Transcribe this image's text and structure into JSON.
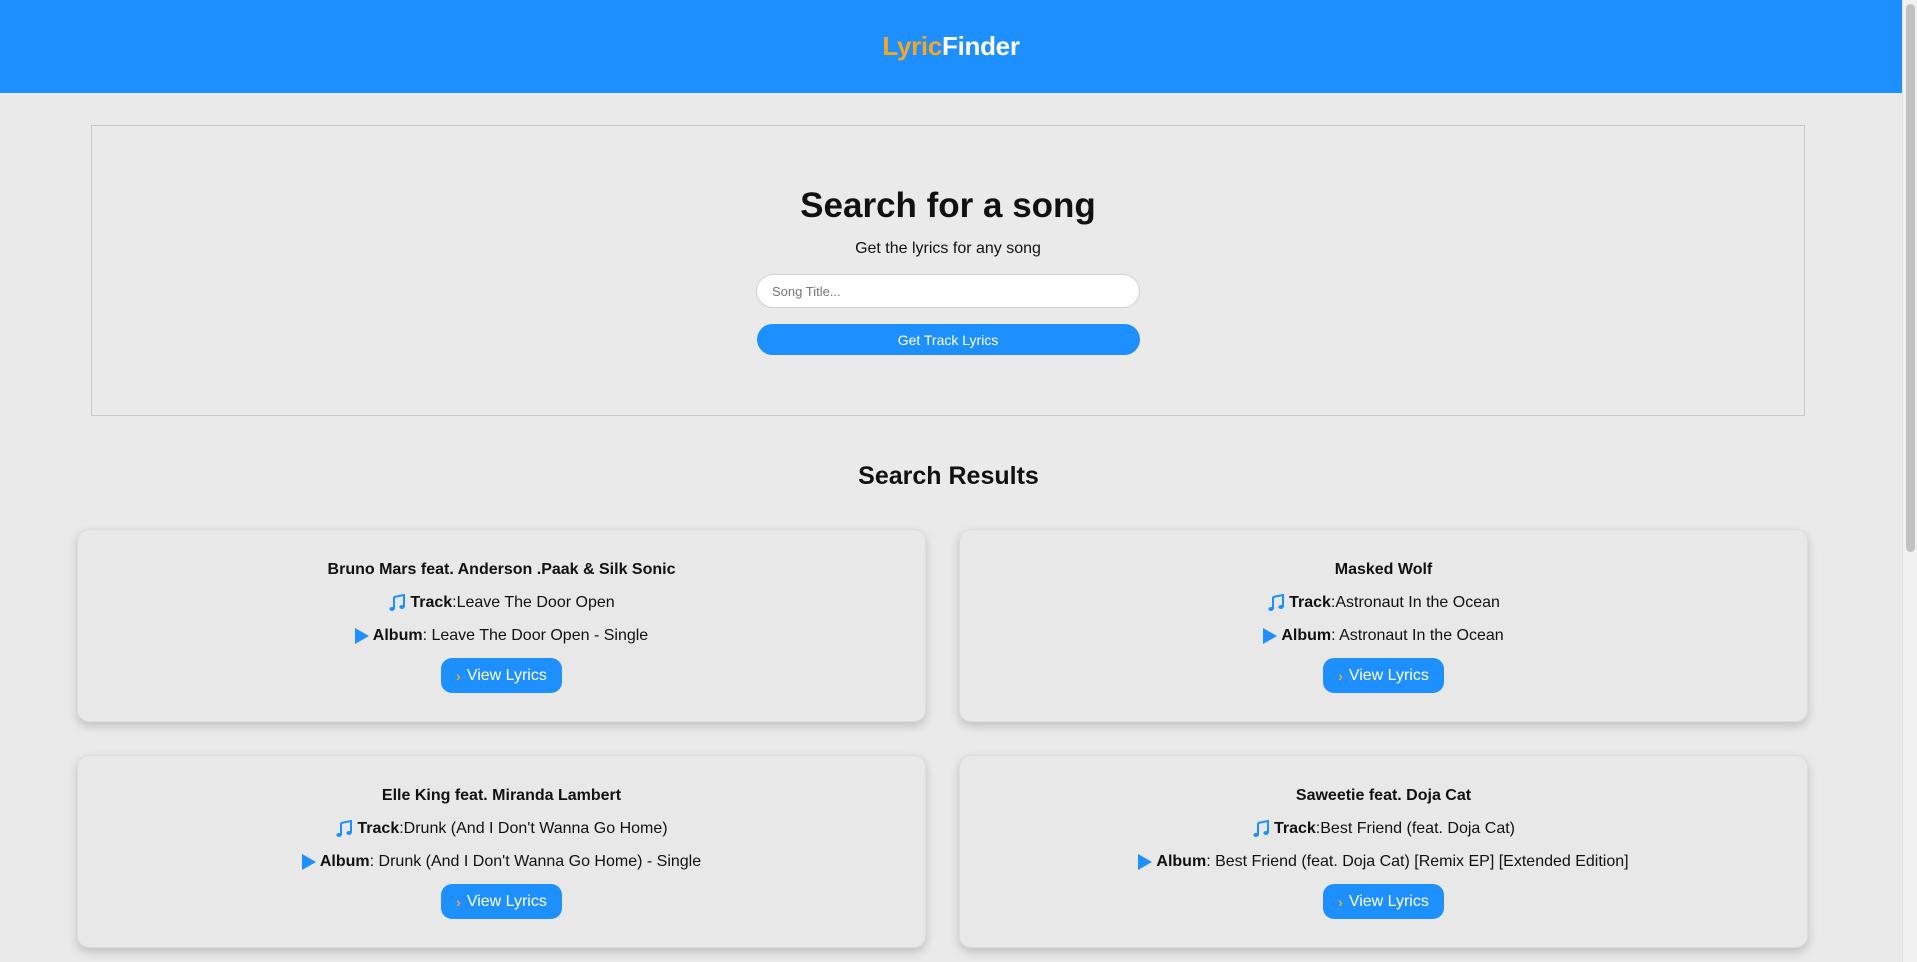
{
  "header": {
    "logo_part1": "Lyric",
    "logo_part2": "Finder"
  },
  "search": {
    "title": "Search for a song",
    "subtitle": "Get the lyrics for any song",
    "input_placeholder": "Song Title...",
    "input_value": "",
    "button_label": "Get Track Lyrics"
  },
  "results": {
    "title": "Search Results",
    "track_label": "Track",
    "album_label": "Album",
    "view_label": "View Lyrics",
    "items": [
      {
        "artist": "Bruno Mars feat. Anderson .Paak & Silk Sonic",
        "track": "Leave The Door Open",
        "album": "Leave The Door Open - Single"
      },
      {
        "artist": "Masked Wolf",
        "track": "Astronaut In the Ocean",
        "album": "Astronaut In the Ocean"
      },
      {
        "artist": "Elle King feat. Miranda Lambert",
        "track": "Drunk (And I Don't Wanna Go Home)",
        "album": "Drunk (And I Don't Wanna Go Home) - Single"
      },
      {
        "artist": "Saweetie feat. Doja Cat",
        "track": "Best Friend (feat. Doja Cat)",
        "album": "Best Friend (feat. Doja Cat) [Remix EP] [Extended Edition]"
      }
    ]
  },
  "colors": {
    "primary": "#1e8fff",
    "accent": "#f5a623",
    "background": "#eaeaea"
  },
  "icons": {
    "track": "music-note-icon",
    "album": "play-icon",
    "view": "chevron-right-icon"
  }
}
